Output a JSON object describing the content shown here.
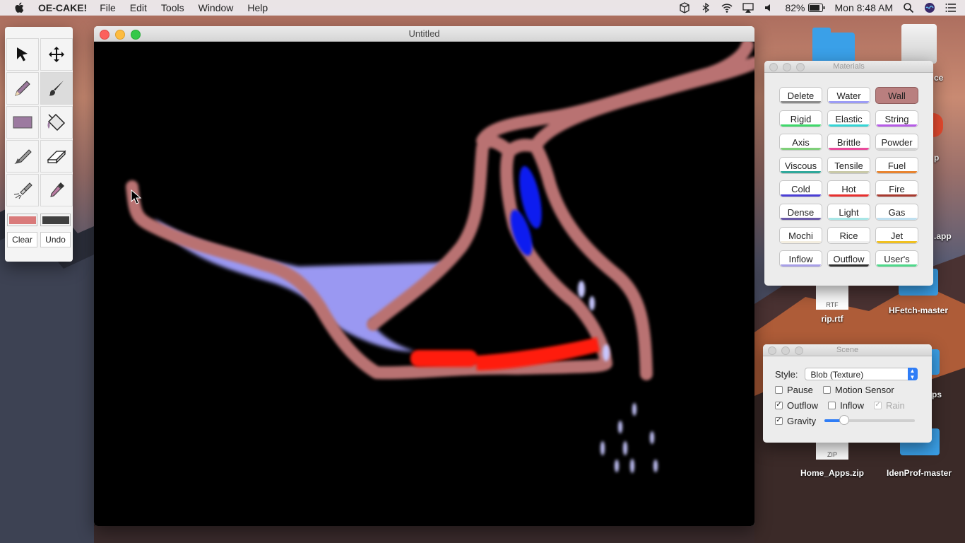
{
  "menubar": {
    "app_name": "OE-CAKE!",
    "menus": [
      "File",
      "Edit",
      "Tools",
      "Window",
      "Help"
    ],
    "battery": "82%",
    "clock": "Mon 8:48 AM"
  },
  "desktop": {
    "icons": [
      "rip.rtf",
      "HFetch-master",
      "Home_Apps.zip",
      "IdenProf-master"
    ],
    "partial_labels": [
      "ce",
      "p",
      ".app",
      "ps"
    ],
    "rtf_tag": "RTF",
    "zip_tag": "ZIP"
  },
  "toolbox": {
    "tools": [
      "select-arrow-icon",
      "move-icon",
      "pencil-icon",
      "brush-icon",
      "rectangle-icon",
      "paint-bucket-icon",
      "knife-icon",
      "eraser-icon",
      "flashlight-icon",
      "eyedropper-icon"
    ],
    "active_tool": "brush-icon",
    "primary_color": "#d97a7a",
    "secondary_color": "#404040",
    "clear_label": "Clear",
    "undo_label": "Undo"
  },
  "canvas_window": {
    "title": "Untitled"
  },
  "materials": {
    "title": "Materials",
    "items": [
      {
        "label": "Delete",
        "color": "#8c8c8c"
      },
      {
        "label": "Water",
        "color": "#9c9cf5"
      },
      {
        "label": "Wall",
        "color": "#b97f7f",
        "selected": true
      },
      {
        "label": "Rigid",
        "color": "#3fd96b"
      },
      {
        "label": "Elastic",
        "color": "#35d6d6"
      },
      {
        "label": "String",
        "color": "#b75ce8"
      },
      {
        "label": "Axis",
        "color": "#7fcf7a"
      },
      {
        "label": "Brittle",
        "color": "#e84b9b"
      },
      {
        "label": "Powder",
        "color": "#d4d4d4"
      },
      {
        "label": "Viscous",
        "color": "#2fa89b"
      },
      {
        "label": "Tensile",
        "color": "#c9c9a8"
      },
      {
        "label": "Fuel",
        "color": "#e8842f"
      },
      {
        "label": "Cold",
        "color": "#4b3fd6"
      },
      {
        "label": "Hot",
        "color": "#e8302f"
      },
      {
        "label": "Fire",
        "color": "#a83a2f"
      },
      {
        "label": "Dense",
        "color": "#6b5ba8"
      },
      {
        "label": "Light",
        "color": "#a8e6e6"
      },
      {
        "label": "Gas",
        "color": "#bfe0f0"
      },
      {
        "label": "Mochi",
        "color": "#f4eee0"
      },
      {
        "label": "Rice",
        "color": "#f0f0f0"
      },
      {
        "label": "Jet",
        "color": "#f0c020"
      },
      {
        "label": "Inflow",
        "color": "#a8a0e8"
      },
      {
        "label": "Outflow",
        "color": "#303030"
      },
      {
        "label": "User's",
        "color": "#4fd98b"
      }
    ]
  },
  "scene": {
    "title": "Scene",
    "style_label": "Style:",
    "style_value": "Blob (Texture)",
    "pause_label": "Pause",
    "pause_checked": false,
    "motion_label": "Motion Sensor",
    "motion_checked": false,
    "outflow_label": "Outflow",
    "outflow_checked": true,
    "inflow_label": "Inflow",
    "inflow_checked": false,
    "rain_label": "Rain",
    "rain_checked": true,
    "gravity_label": "Gravity",
    "gravity_checked": true,
    "gravity_level": 0.22
  }
}
